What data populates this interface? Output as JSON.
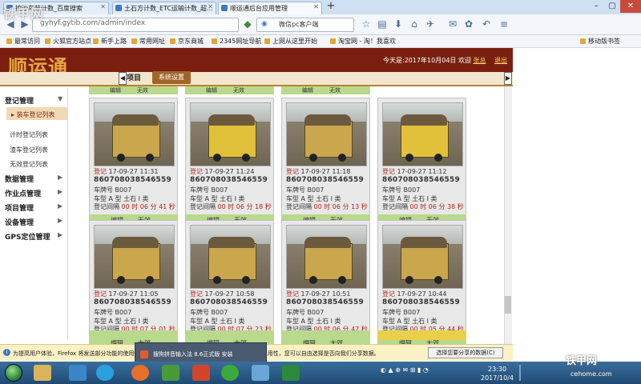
{
  "browser": {
    "tabs": [
      {
        "label": "挖沙车装计数_百度搜索"
      },
      {
        "label": "土石方计数_ETC运输计数_超..."
      },
      {
        "label": "顺运通后台应用管理"
      }
    ],
    "new_tab": "+",
    "url": "gyhyf.gytib.com/admin/index",
    "search_text": "微信pc客户端",
    "bookmarks": [
      "最常访问",
      "火狐官方站点",
      "新手上路",
      "常用网址",
      "京东商城",
      "2345网址导航",
      "上网从这里开始",
      "淘宝网 - 淘！我喜欢"
    ],
    "mobile_bookmarks": "移动版书签"
  },
  "app": {
    "logo": "顺运通",
    "header_info": {
      "today": "今天是:2017年10月04日",
      "welcome": "欢迎",
      "user": "张总",
      "logout": "退出"
    },
    "tabs": {
      "project": "项目",
      "system": "系统设置"
    },
    "sidebar": {
      "groups": [
        {
          "label": "登记管理"
        },
        {
          "label": "数据管理"
        },
        {
          "label": "作业点管理"
        },
        {
          "label": "项目管理"
        },
        {
          "label": "设备管理"
        },
        {
          "label": "GPS定位管理"
        }
      ],
      "active_item": "装车登记列表",
      "sub_items": [
        "计时登记列表",
        "渣车登记列表",
        "无效登记列表"
      ]
    },
    "card_actions": {
      "edit": "编辑",
      "invalid": "无效"
    },
    "cards": [
      {
        "status": "登记",
        "time": "17-09-27 11:31",
        "device": "860708038546559",
        "plate": "车牌号 B007",
        "type": "车型 A 型 土石 I 类",
        "interval_label": "登记间隔",
        "interval": "00 时 06 分 41 秒"
      },
      {
        "status": "登记",
        "time": "17-09-27 11:24",
        "device": "860708038546559",
        "plate": "车牌号 B007",
        "type": "车型 A 型 土石 I 类",
        "interval_label": "登记间隔",
        "interval": "00 时 06 分 18 秒"
      },
      {
        "status": "登记",
        "time": "17-09-27 11:18",
        "device": "860708038546559",
        "plate": "车牌号 B007",
        "type": "车型 A 型 土石 I 类",
        "interval_label": "登记间隔",
        "interval": "00 时 06 分 13 秒"
      },
      {
        "status": "登记",
        "time": "17-09-27 11:12",
        "device": "860708038546559",
        "plate": "车牌号 B007",
        "type": "车型 A 型 土石 I 类",
        "interval_label": "登记间隔",
        "interval": "00 时 06 分 38 秒"
      },
      {
        "status": "登记",
        "time": "17-09-27 11:05",
        "device": "860708038546559",
        "plate": "车牌号 B007",
        "type": "车型 A 型 土石 I 类",
        "interval_label": "登记间隔",
        "interval": "00 时 07 分 01 秒"
      },
      {
        "status": "登记",
        "time": "17-09-27 10:58",
        "device": "860708038546559",
        "plate": "车牌号 B007",
        "type": "车型 A 型 土石 I 类",
        "interval_label": "登记间隔",
        "interval": "00 时 07 分 23 秒"
      },
      {
        "status": "登记",
        "time": "17-09-27 10:51",
        "device": "860708038546559",
        "plate": "车牌号 B007",
        "type": "车型 A 型 土石 I 类",
        "interval_label": "登记间隔",
        "interval": "00 时 06 分 47 秒"
      },
      {
        "status": "登记",
        "time": "17-09-27 10:44",
        "device": "860708038546559",
        "plate": "车牌号 B007",
        "type": "车型 A 型 土石 I 类",
        "interval_label": "登记间隔",
        "interval": "00 时 05 分 44 秒"
      }
    ]
  },
  "notification": {
    "text": "为提高用户体验，Firefox 将发送部分功能的使用情况给 Mozilla，以便我们进一步优化火狐浏览器的易用性，您可以自由选择是否向我们分享数据。",
    "button": "选择您要分享的数据(C)"
  },
  "ime_popup": "搜狗拼音输入法 8.6正式版 安装",
  "taskbar": {
    "time": "23:30",
    "date": "2017/10/4"
  },
  "watermarks": {
    "left": "铁甲网",
    "right": "铁甲网",
    "url": "cehome.com"
  },
  "colors": {
    "header": "#7a1f0f",
    "logo": "#e8a642",
    "accent_tab": "#a0652a",
    "action_bar": "#b9d98c",
    "status_red": "#b3261e"
  }
}
